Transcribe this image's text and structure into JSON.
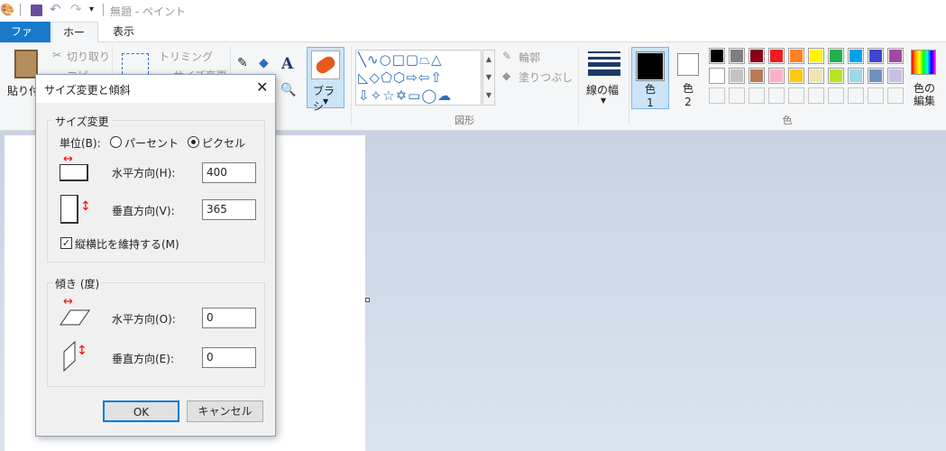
{
  "titlebar": {
    "title": "無題 - ペイント"
  },
  "tabs": [
    {
      "label": "ファイル"
    },
    {
      "label": "ホーム"
    },
    {
      "label": "表示"
    }
  ],
  "ribbon": {
    "paste": "貼り付け",
    "cut": "切り取り",
    "copy": "コピー",
    "trim": "トリミング",
    "resize": "サイズ変更",
    "brush": "ブラシ",
    "outline": "輪郭",
    "fill": "塗りつぶし",
    "shapes_group": "図形",
    "line_width": "線の幅",
    "color1": "色",
    "color1_num": "1",
    "color2": "色",
    "color2_num": "2",
    "edit_colors": "色の編集",
    "colors_group": "色",
    "color1_value": "#000000",
    "color2_value": "#ffffff",
    "palette": [
      "#000000",
      "#7f7f7f",
      "#880015",
      "#ed1c24",
      "#ff7f27",
      "#fff200",
      "#22b14c",
      "#00a2e8",
      "#3f48cc",
      "#a349a4",
      "#ffffff",
      "#c3c3c3",
      "#b97a57",
      "#ffaec9",
      "#ffc90e",
      "#efe4b0",
      "#b5e61d",
      "#99d9ea",
      "#7092be",
      "#c8bfe7"
    ]
  },
  "dialog": {
    "title": "サイズ変更と傾斜",
    "resize_group": "サイズ変更",
    "unit_label": "単位(B):",
    "percent": "パーセント",
    "pixel": "ピクセル",
    "selected_unit": "ピクセル",
    "horizontal_label": "水平方向(H):",
    "horizontal_value": "400",
    "vertical_label": "垂直方向(V):",
    "vertical_value": "365",
    "keep_ratio": "縦横比を維持する(M)",
    "keep_ratio_checked": true,
    "skew_group": "傾き (度)",
    "skew_h_label": "水平方向(O):",
    "skew_h_value": "0",
    "skew_v_label": "垂直方向(E):",
    "skew_v_value": "0",
    "ok": "OK",
    "cancel": "キャンセル"
  }
}
